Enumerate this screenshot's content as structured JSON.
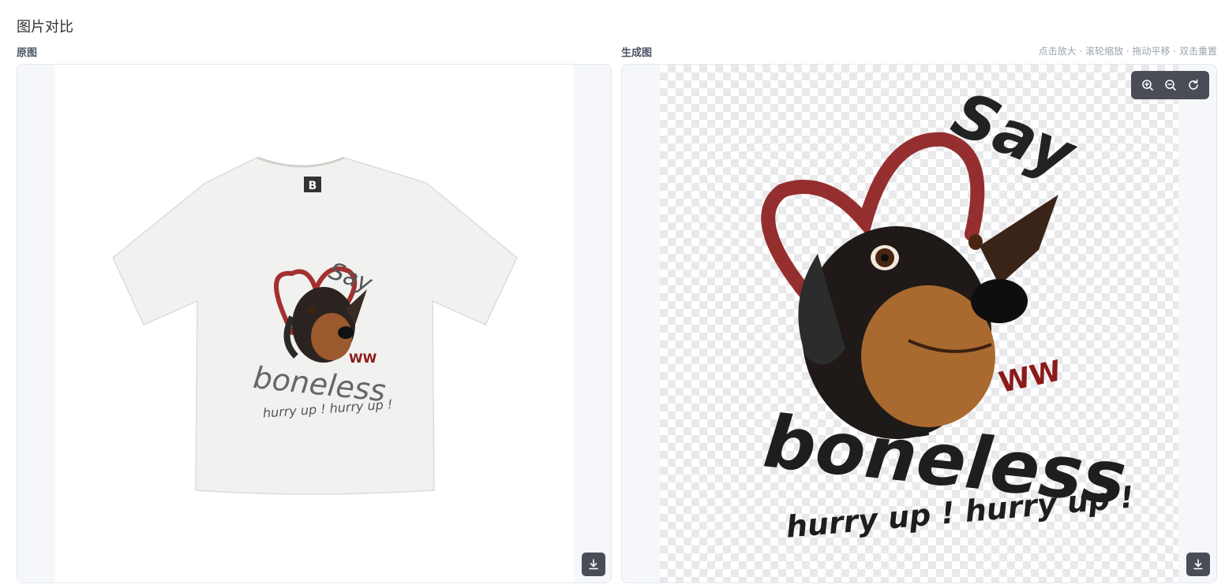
{
  "page": {
    "title": "图片对比"
  },
  "left_panel": {
    "label": "原图"
  },
  "right_panel": {
    "label": "生成图"
  },
  "hint": "点击放大 · 滚轮缩放 · 拖动平移 · 双击重置",
  "artwork": {
    "word_say": "Say",
    "word_boneless": "boneless",
    "word_hurry": "hurry up ! hurry up !",
    "tag_letter": "B"
  },
  "icons": {
    "zoom_in": "zoom-in-icon",
    "zoom_out": "zoom-out-icon",
    "reset": "rotate-reset-icon",
    "download": "download-icon"
  },
  "colors": {
    "toolbar_bg": "#4a4d56",
    "heart": "#8b1a1a",
    "ink": "#222222",
    "shirt": "#f1f1ef"
  }
}
